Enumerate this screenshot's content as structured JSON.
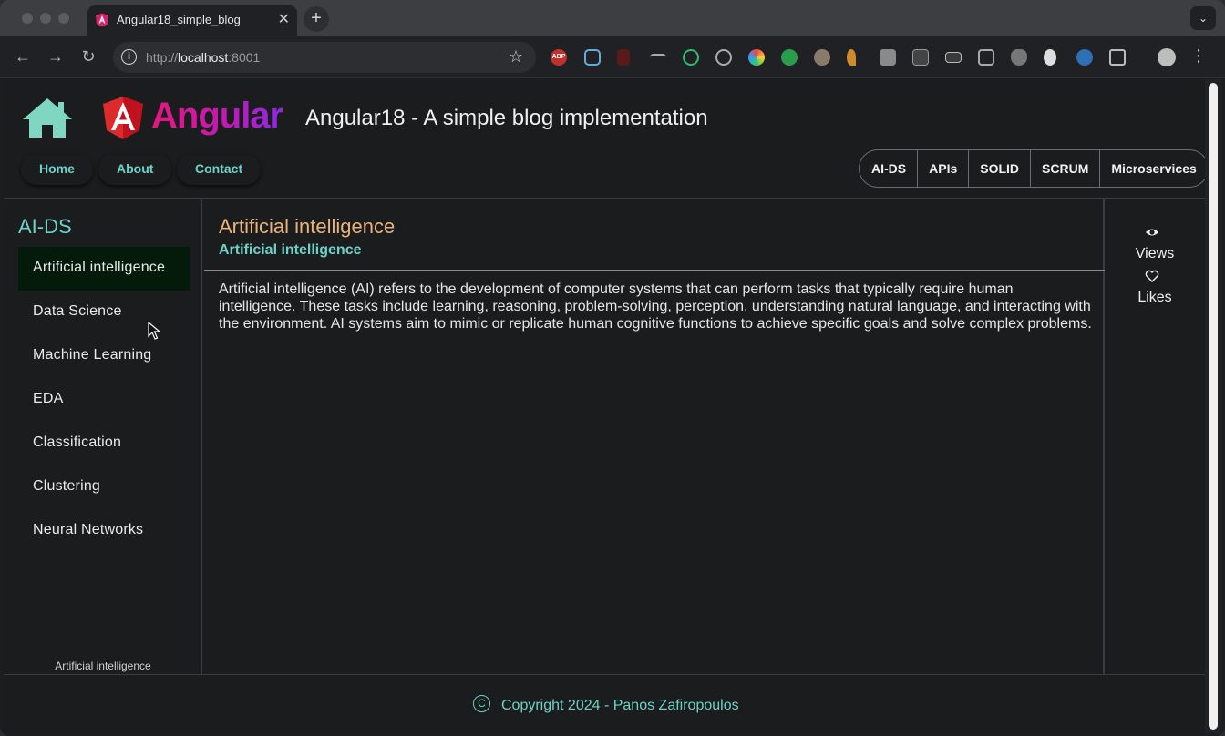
{
  "browser": {
    "tab_title": "Angular18_simple_blog",
    "tab_close": "✕",
    "new_tab": "+",
    "tab_menu": "⌄",
    "url_scheme_host": "http://",
    "url_host": "localhost",
    "url_port": ":8001",
    "info_glyph": "i",
    "star_glyph": "☆",
    "back_glyph": "←",
    "forward_glyph": "→",
    "reload_glyph": "↻",
    "kebab_glyph": "⋮",
    "ext_abp_label": "ABP"
  },
  "header": {
    "brand_word": "Angular",
    "site_title": "Angular18 - A simple blog implementation",
    "nav": [
      "Home",
      "About",
      "Contact"
    ],
    "categories": [
      "AI-DS",
      "APIs",
      "SOLID",
      "SCRUM",
      "Microservices"
    ]
  },
  "sidebar": {
    "title": "AI-DS",
    "items": [
      "Artificial intelligence",
      "Data Science",
      "Machine Learning",
      "EDA",
      "Classification",
      "Clustering",
      "Neural Networks"
    ],
    "active_index": 0,
    "footer": "Artificial intelligence"
  },
  "main": {
    "title": "Artificial intelligence",
    "subtitle": "Artificial intelligence",
    "body": "Artificial intelligence (AI) refers to the development of computer systems that can perform tasks that typically require human intelligence. These tasks include learning, reasoning, problem-solving, perception, understanding natural language, and interacting with the environment. AI systems aim to mimic or replicate human cognitive functions to achieve specific goals and solve complex problems."
  },
  "stats": {
    "views_label": "Views",
    "likes_label": "Likes",
    "views_icon": "eye-icon",
    "likes_icon": "heart-icon"
  },
  "footer": {
    "copyright_glyph": "C",
    "text": "Copyright 2024 - Panos Zafiropoulos"
  },
  "colors": {
    "accent_teal": "#6ed1c7",
    "title_orange": "#e8b47a",
    "active_item_bg": "#041a0b",
    "page_bg": "#1a1c1e"
  }
}
